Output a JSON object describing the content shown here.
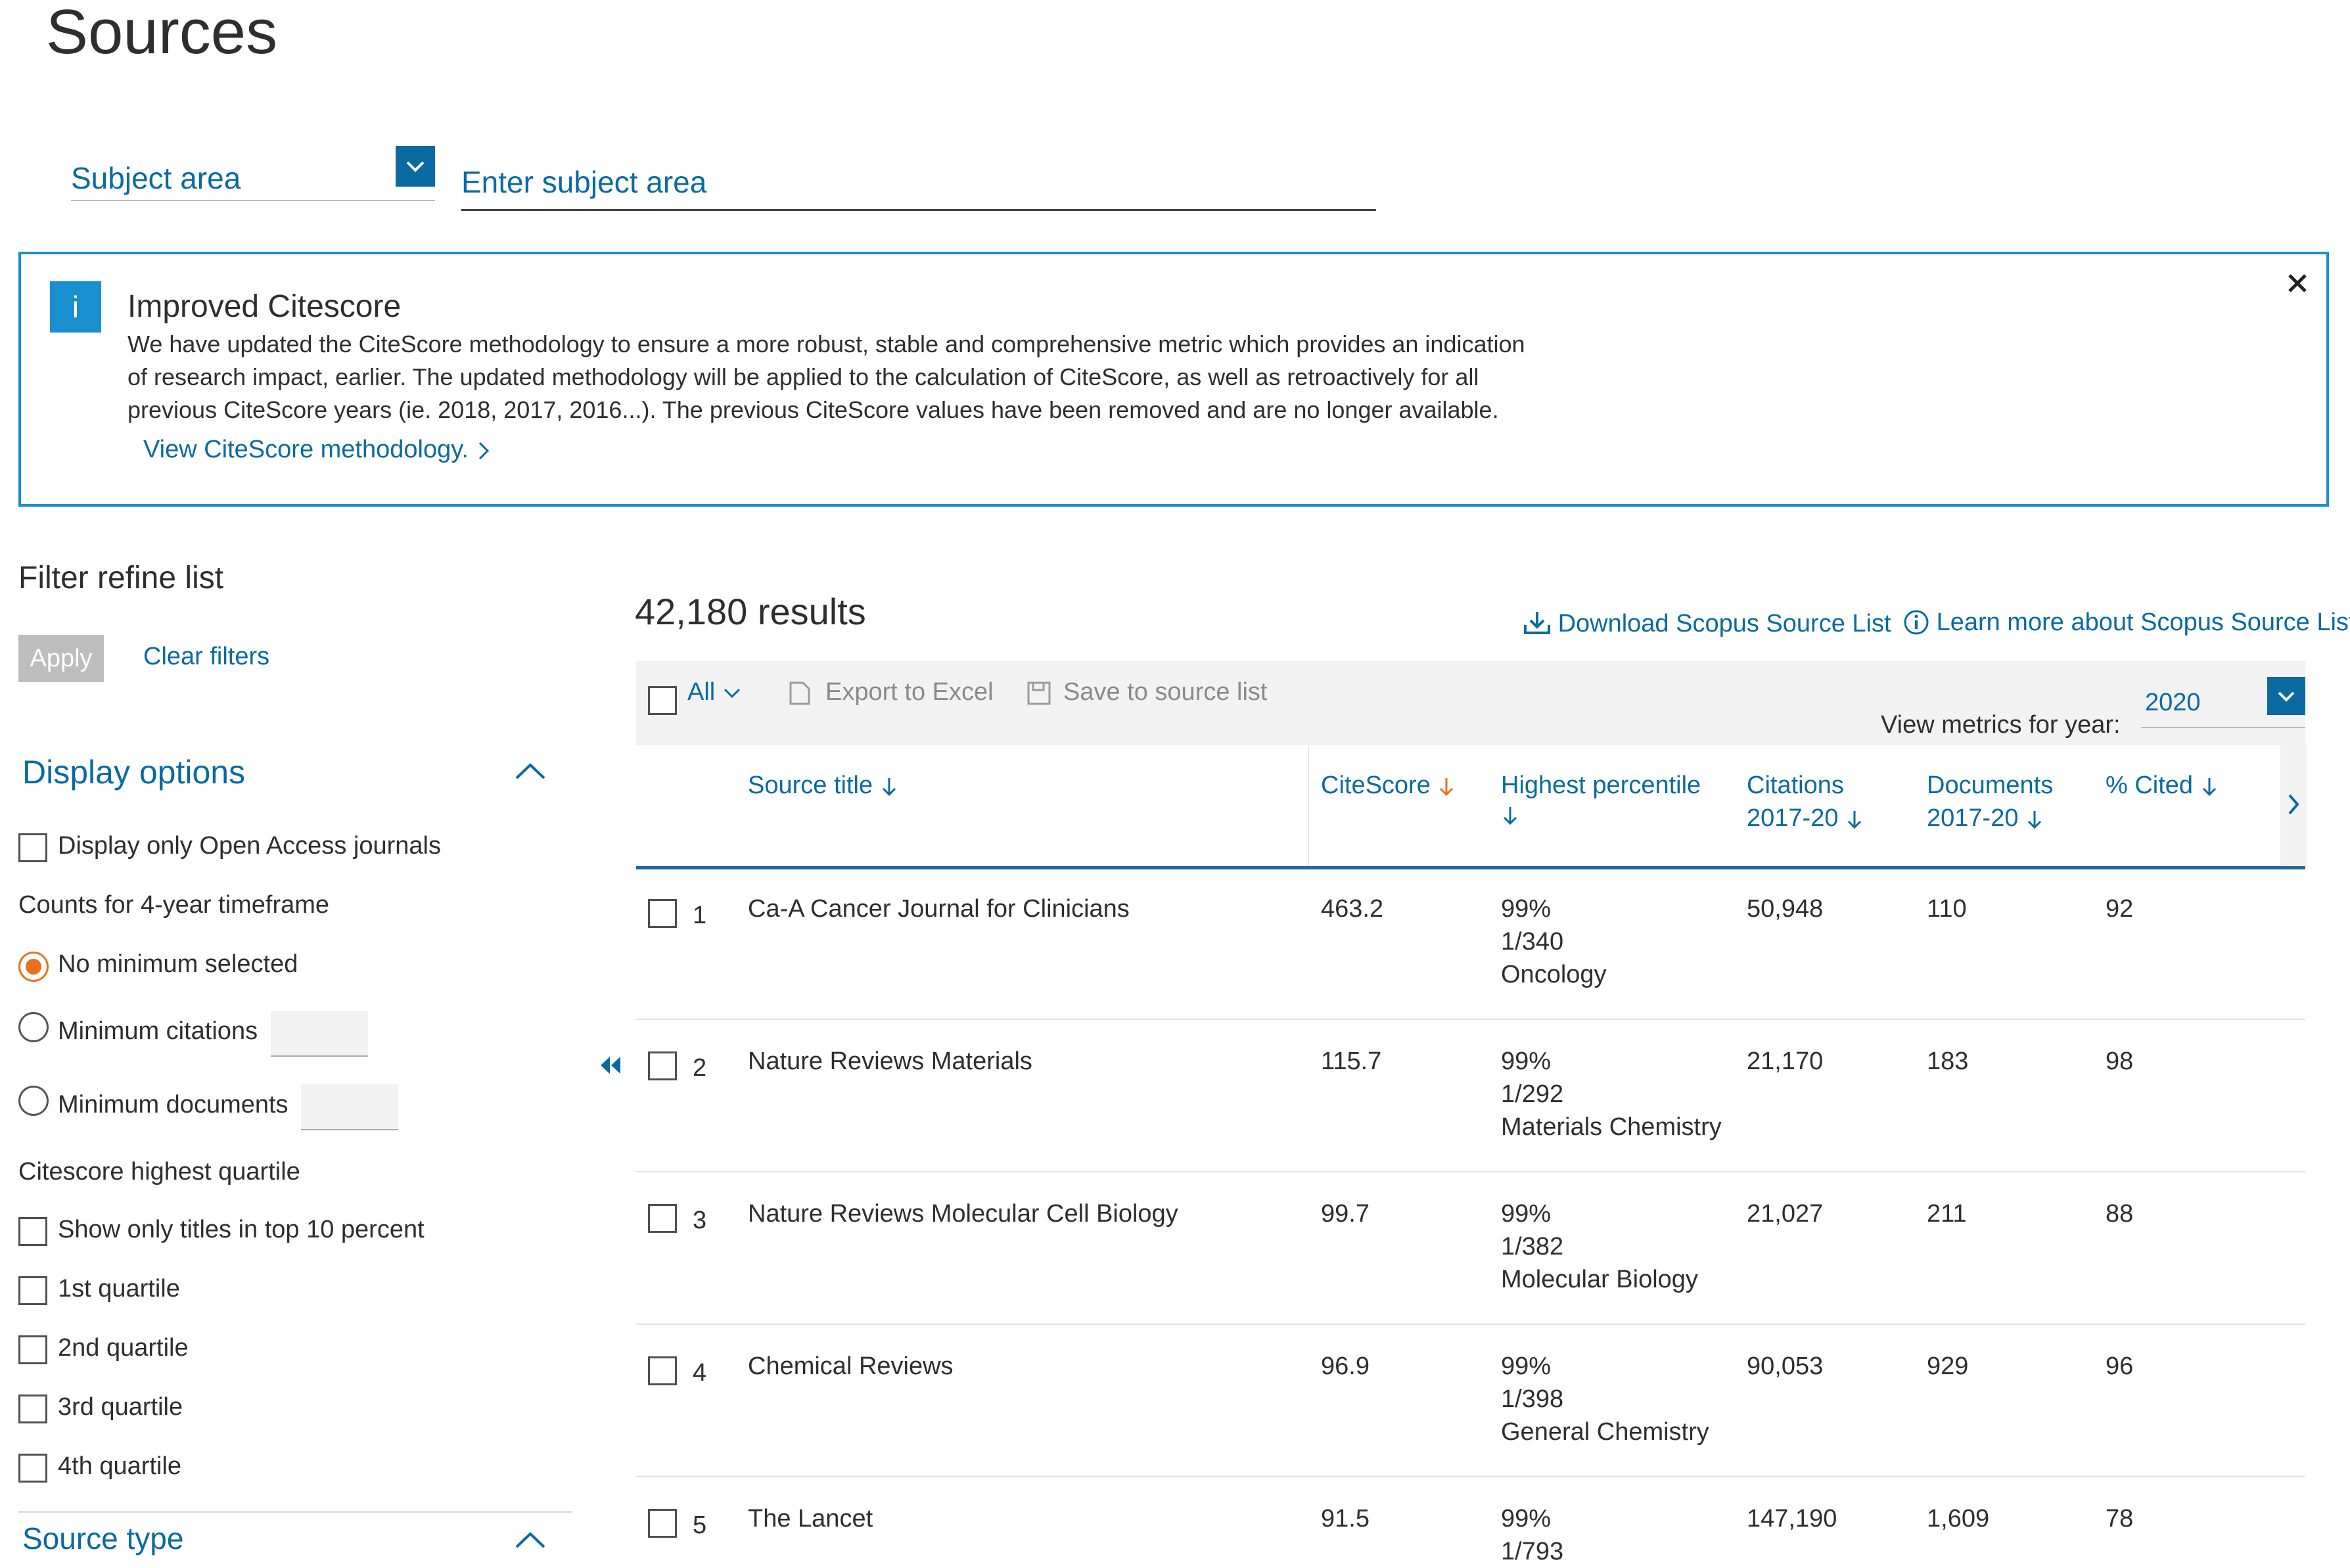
{
  "page": {
    "title": "Sources"
  },
  "subject": {
    "select_label": "Subject area",
    "input_placeholder": "Enter subject area"
  },
  "banner": {
    "info_glyph": "i",
    "title": "Improved Citescore",
    "lines": [
      "We have updated the CiteScore methodology to ensure a more robust, stable and comprehensive metric which provides an indication",
      "of research impact, earlier. The updated methodology will be applied to the calculation of CiteScore, as well as retroactively for all",
      "previous CiteScore years (ie. 2018, 2017, 2016...). The previous CiteScore values have been removed and are no longer available."
    ],
    "link": "View CiteScore methodology."
  },
  "sidebar": {
    "title": "Filter refine list",
    "apply": "Apply",
    "clear": "Clear filters",
    "display_options": "Display options",
    "open_access": "Display only Open Access journals",
    "counts_label": "Counts for 4-year timeframe",
    "radio": {
      "none": "No minimum selected",
      "citations": "Minimum citations",
      "documents": "Minimum documents"
    },
    "quartile_heading": "Citescore highest quartile",
    "quartiles": [
      "Show only titles in top 10 percent",
      "1st quartile",
      "2nd quartile",
      "3rd quartile",
      "4th quartile"
    ],
    "source_type": "Source type"
  },
  "results": {
    "count": "42,180 results",
    "download": "Download Scopus Source List",
    "learn_more": "Learn more about Scopus Source List"
  },
  "toolbar": {
    "all": "All",
    "export": "Export to Excel",
    "save": "Save to source list",
    "metrics_label": "View metrics for year:",
    "year": "2020"
  },
  "columns": {
    "title": "Source title",
    "citescore": "CiteScore",
    "percentile": "Highest percentile",
    "citations": [
      "Citations",
      "2017-20"
    ],
    "documents": [
      "Documents",
      "2017-20"
    ],
    "cited": "% Cited"
  },
  "rows": [
    {
      "num": "1",
      "title": "Ca-A Cancer Journal for Clinicians",
      "citescore": "463.2",
      "pct": "99%",
      "rank": "1/340",
      "field": "Oncology",
      "citations": "50,948",
      "documents": "110",
      "cited": "92"
    },
    {
      "num": "2",
      "title": "Nature Reviews Materials",
      "citescore": "115.7",
      "pct": "99%",
      "rank": "1/292",
      "field": "Materials Chemistry",
      "citations": "21,170",
      "documents": "183",
      "cited": "98"
    },
    {
      "num": "3",
      "title": "Nature Reviews Molecular Cell Biology",
      "citescore": "99.7",
      "pct": "99%",
      "rank": "1/382",
      "field": "Molecular Biology",
      "citations": "21,027",
      "documents": "211",
      "cited": "88"
    },
    {
      "num": "4",
      "title": "Chemical Reviews",
      "citescore": "96.9",
      "pct": "99%",
      "rank": "1/398",
      "field": "General Chemistry",
      "citations": "90,053",
      "documents": "929",
      "cited": "96"
    },
    {
      "num": "5",
      "title": "The Lancet",
      "citescore": "91.5",
      "pct": "99%",
      "rank": "1/793",
      "field": "",
      "citations": "147,190",
      "documents": "1,609",
      "cited": "78"
    }
  ],
  "colors": {
    "link": "#0a6aa1",
    "accent": "#1a8fcf",
    "radio_selected": "#e9711c",
    "sort_active": "#e9711c"
  }
}
